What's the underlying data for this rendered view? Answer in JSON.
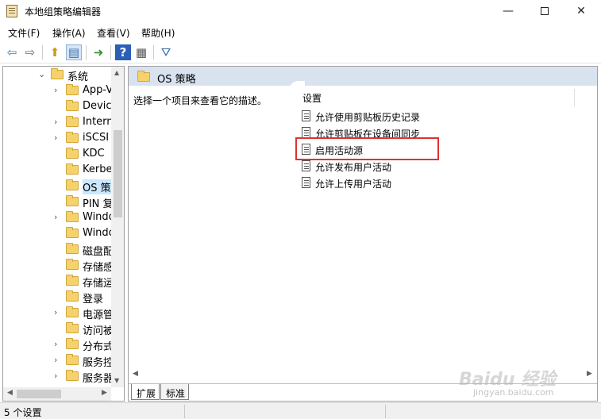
{
  "window": {
    "title": "本地组策略编辑器",
    "min": "—",
    "close": "✕"
  },
  "menu": [
    "文件(F)",
    "操作(A)",
    "查看(V)",
    "帮助(H)"
  ],
  "toolbar": {
    "back": "⇦",
    "forward": "⇨",
    "up": "⬆",
    "show_tree": "▤",
    "export": "➜",
    "help": "?",
    "properties": "▦",
    "filter": "⛛"
  },
  "tree": {
    "parent": {
      "label": "系统",
      "arrow": "⌄"
    },
    "items": [
      {
        "label": "App-V",
        "arrow": "›"
      },
      {
        "label": "Device",
        "arrow": ""
      },
      {
        "label": "Interne",
        "arrow": "›"
      },
      {
        "label": "iSCSI",
        "arrow": "›"
      },
      {
        "label": "KDC",
        "arrow": ""
      },
      {
        "label": "Kerbe",
        "arrow": ""
      },
      {
        "label": "OS 策",
        "arrow": ""
      },
      {
        "label": "PIN 复",
        "arrow": ""
      },
      {
        "label": "Windo",
        "arrow": "›"
      },
      {
        "label": "Windo",
        "arrow": ""
      },
      {
        "label": "磁盘配",
        "arrow": ""
      },
      {
        "label": "存储感",
        "arrow": ""
      },
      {
        "label": "存储运",
        "arrow": ""
      },
      {
        "label": "登录",
        "arrow": ""
      },
      {
        "label": "电源管",
        "arrow": "›"
      },
      {
        "label": "访问被",
        "arrow": ""
      },
      {
        "label": "分布式",
        "arrow": "›"
      },
      {
        "label": "服务控",
        "arrow": "›"
      },
      {
        "label": "服务器",
        "arrow": "›"
      }
    ],
    "scroll_up": "▲",
    "scroll_down": "▼",
    "scroll_left": "◀",
    "scroll_right": "▶"
  },
  "details": {
    "header": "OS 策略",
    "description": "选择一个项目来查看它的描述。",
    "column": "设置",
    "settings": [
      "允许使用剪贴板历史记录",
      "允许剪贴板在设备间同步",
      "启用活动源",
      "允许发布用户活动",
      "允许上传用户活动"
    ],
    "scroll_left": "◀",
    "scroll_right": "▶"
  },
  "tabs": [
    "扩展",
    "标准"
  ],
  "status": {
    "text": "5 个设置"
  },
  "watermark": {
    "text": "Baidu 经验",
    "sub": "jingyan.baidu.com"
  },
  "colors": {
    "highlight": "#e03232",
    "header_bg": "#d9e2ef",
    "selection": "#cce8ff"
  }
}
